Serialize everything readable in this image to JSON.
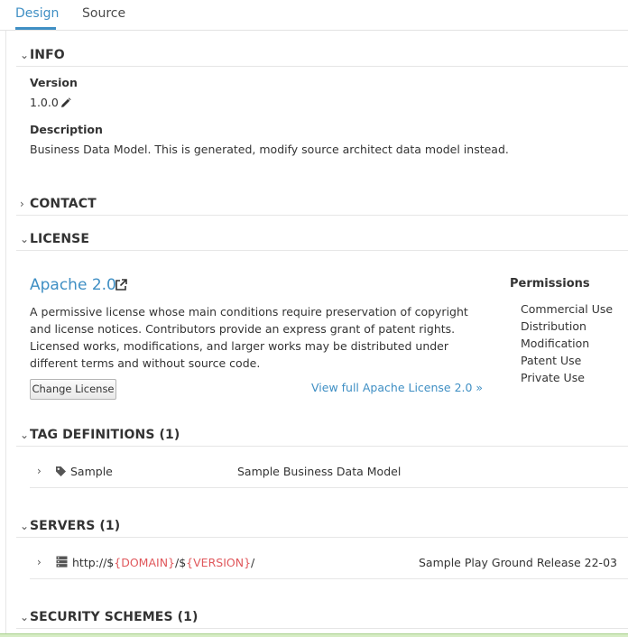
{
  "tabs": [
    {
      "label": "Design",
      "active": true
    },
    {
      "label": "Source",
      "active": false
    }
  ],
  "info": {
    "title": "INFO",
    "version_label": "Version",
    "version_value": "1.0.0",
    "description_label": "Description",
    "description_value": "Business Data Model. This is generated, modify source architect data model instead."
  },
  "contact": {
    "title": "CONTACT"
  },
  "license": {
    "title": "LICENSE",
    "name": "Apache 2.0",
    "description_lines": [
      "A permissive license whose main conditions require preservation of copyright",
      "and license notices. Contributors provide an express grant of patent rights.",
      "Licensed works, modifications, and larger works may be distributed under",
      "different terms and without source code."
    ],
    "change_button": "Change License",
    "view_full_link": "View full Apache License 2.0 »",
    "permissions_title": "Permissions",
    "permissions": [
      "Commercial Use",
      "Distribution",
      "Modification",
      "Patent Use",
      "Private Use"
    ]
  },
  "tag_definitions": {
    "title": "TAG DEFINITIONS (1)",
    "items": [
      {
        "name": "Sample",
        "description": "Sample Business Data Model"
      }
    ]
  },
  "servers": {
    "title": "SERVERS (1)",
    "items": [
      {
        "url_prefix": "http://$",
        "var1": "{DOMAIN}",
        "sep": "/$",
        "var2": "{VERSION}",
        "url_suffix": "/",
        "description": "Sample Play Ground Release 22-03"
      }
    ]
  },
  "security_schemes": {
    "title": "SECURITY SCHEMES (1)"
  },
  "colors": {
    "accent": "#3f8fc4",
    "server_variable": "#e0585c"
  },
  "icons": {
    "expanded": "chevron-down-icon",
    "collapsed": "chevron-right-icon",
    "edit": "pencil-icon",
    "external": "external-link-icon",
    "tag": "tag-icon",
    "server": "server-icon"
  }
}
